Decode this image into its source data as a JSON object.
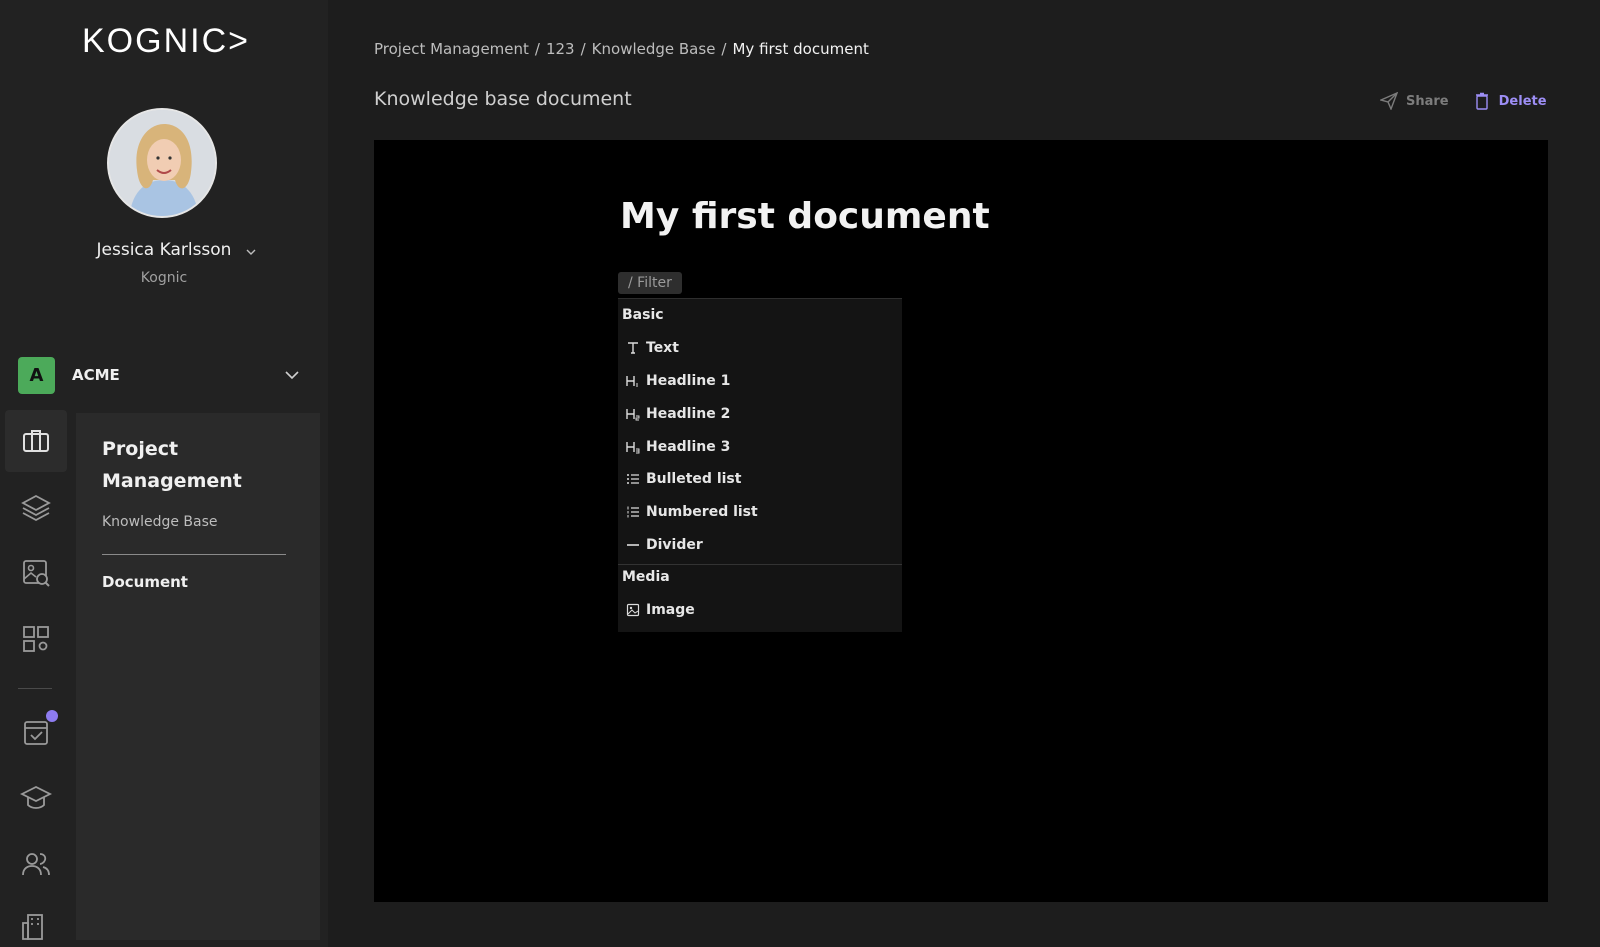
{
  "brand": {
    "logo_text": "KOGNIC>"
  },
  "user": {
    "name": "Jessica Karlsson",
    "org": "Kognic"
  },
  "organization": {
    "badge": "A",
    "name": "ACME"
  },
  "subnav": {
    "title": "Project Management",
    "link": "Knowledge Base",
    "active": "Document"
  },
  "breadcrumb": {
    "items": [
      "Project Management",
      "123",
      "Knowledge Base"
    ],
    "current": "My first document",
    "separator": "/"
  },
  "page": {
    "title": "Knowledge base document"
  },
  "actions": {
    "share": "Share",
    "delete": "Delete"
  },
  "document": {
    "title": "My first document"
  },
  "command_menu": {
    "filter": "/ Filter",
    "sections": [
      {
        "label": "Basic",
        "items": [
          {
            "label": "Text",
            "icon": "text-icon"
          },
          {
            "label": "Headline 1",
            "icon": "heading-1-icon"
          },
          {
            "label": "Headline 2",
            "icon": "heading-2-icon"
          },
          {
            "label": "Headline 3",
            "icon": "heading-3-icon"
          },
          {
            "label": "Bulleted list",
            "icon": "bulleted-list-icon"
          },
          {
            "label": "Numbered list",
            "icon": "numbered-list-icon"
          },
          {
            "label": "Divider",
            "icon": "divider-icon"
          }
        ]
      },
      {
        "label": "Media",
        "items": [
          {
            "label": "Image",
            "icon": "image-icon"
          }
        ]
      }
    ]
  },
  "colors": {
    "accent": "#9d8ef5",
    "org_badge": "#4caa5a",
    "notification": "#8e7cf0"
  }
}
